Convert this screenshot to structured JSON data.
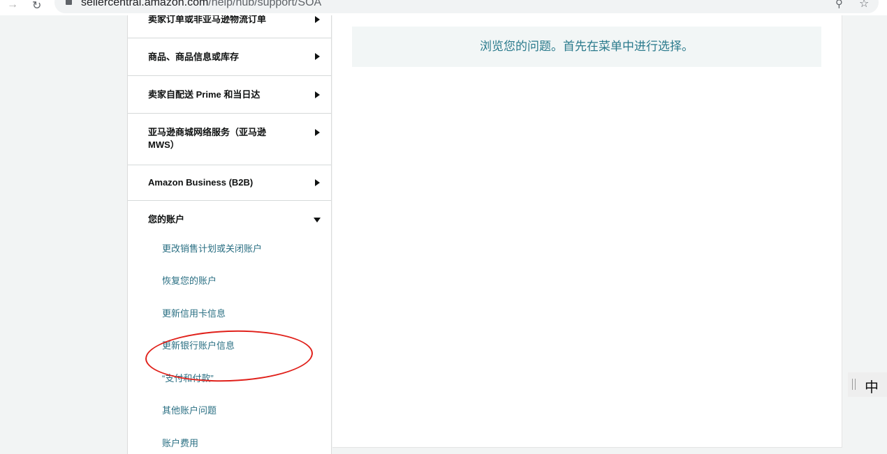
{
  "browser": {
    "url_domain": "sellercentral.amazon.com",
    "url_path": "/help/hub/support/SOA",
    "forward_icon": "arrow-right-icon",
    "reload_icon": "reload-icon"
  },
  "sidebar": {
    "categories": [
      {
        "label": "卖家订单或非亚马逊物流订单",
        "state": "collapsed"
      },
      {
        "label": "商品、商品信息或库存",
        "state": "collapsed"
      },
      {
        "label": "卖家自配送 Prime 和当日达",
        "state": "collapsed"
      },
      {
        "label": "亚马逊商城网络服务（亚马逊 MWS）",
        "state": "collapsed"
      },
      {
        "label": "Amazon Business (B2B)",
        "state": "collapsed"
      },
      {
        "label": "您的账户",
        "state": "expanded"
      }
    ],
    "account_subitems": [
      "更改销售计划或关闭账户",
      "恢复您的账户",
      "更新信用卡信息",
      "更新银行账户信息",
      "“支付和付款”",
      "其他账户问题",
      "账户费用"
    ]
  },
  "main": {
    "banner_text": "浏览您的问题。首先在菜单中进行选择。"
  },
  "ime": {
    "label": "中"
  },
  "colors": {
    "link": "#2a6f83",
    "banner_text": "#2a7a8c",
    "annotation": "#e0201a"
  }
}
